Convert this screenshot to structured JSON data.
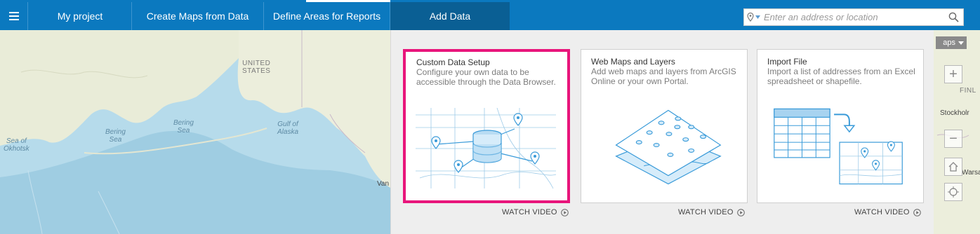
{
  "nav": {
    "tabs": [
      {
        "label": "My project"
      },
      {
        "label": "Create Maps from Data"
      },
      {
        "label": "Define Areas for Reports"
      },
      {
        "label": "Add Data"
      }
    ],
    "active_tab": "Add Data",
    "search_placeholder": "Enter an address or location",
    "icons": {
      "menu": "hamburger-icon",
      "pin": "location-pin-icon",
      "search": "search-icon"
    }
  },
  "map": {
    "labels": {
      "united_states": "UNITED\nSTATES",
      "sea_okhotsk": "Sea of\nOkhotsk",
      "bering_sea_1": "Bering\nSea",
      "bering_sea_2": "Bering\nSea",
      "gulf_alaska": "Gulf of\nAlaska",
      "van": "Van",
      "stockholm": "Stockholr",
      "finl": "FINL",
      "warsa": "Warsa"
    },
    "basemap_label": "aps",
    "zoom_in": "+",
    "zoom_out": "−"
  },
  "panel": {
    "cards": [
      {
        "title": "Custom Data Setup",
        "description": "Configure your own data to be accessible through the Data Browser.",
        "watch": "WATCH VIDEO",
        "selected": true
      },
      {
        "title": "Web Maps and Layers",
        "description": "Add web maps and layers from ArcGIS Online or your own Portal.",
        "watch": "WATCH VIDEO",
        "selected": false
      },
      {
        "title": "Import File",
        "description": "Import a list of addresses from an Excel spreadsheet or shapefile.",
        "watch": "WATCH VIDEO",
        "selected": false
      }
    ]
  },
  "colors": {
    "nav_blue": "#0b79bf",
    "nav_active": "#0a5f94",
    "highlight": "#e8157b",
    "illustration_blue": "#3a9bd9"
  }
}
